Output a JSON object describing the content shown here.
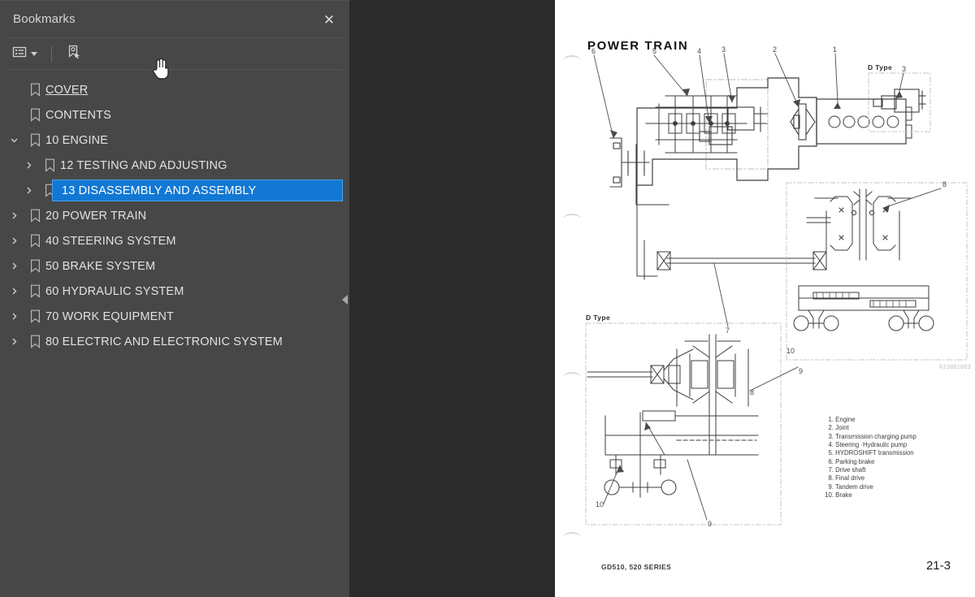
{
  "panel": {
    "title": "Bookmarks",
    "close_label": "✕",
    "toolbar": {
      "options_icon": "list-options-icon",
      "options_caret": "chevron-down-icon",
      "new_bookmark_icon": "new-bookmark-icon"
    },
    "collapse_icon": "collapse-panel-left-icon",
    "items": [
      {
        "label": "COVER",
        "depth": 0,
        "twisty": "none",
        "selected": false,
        "link": true
      },
      {
        "label": "CONTENTS",
        "depth": 0,
        "twisty": "none",
        "selected": false,
        "link": false
      },
      {
        "label": "10 ENGINE",
        "depth": 0,
        "twisty": "expanded",
        "selected": false,
        "link": false
      },
      {
        "label": "12 TESTING AND ADJUSTING",
        "depth": 1,
        "twisty": "collapsed",
        "selected": false,
        "link": false
      },
      {
        "label": "13 DISASSEMBLY AND ASSEMBLY",
        "depth": 1,
        "twisty": "collapsed",
        "selected": true,
        "link": false
      },
      {
        "label": "20 POWER TRAIN",
        "depth": 0,
        "twisty": "collapsed",
        "selected": false,
        "link": false
      },
      {
        "label": "40 STEERING SYSTEM",
        "depth": 0,
        "twisty": "collapsed",
        "selected": false,
        "link": false
      },
      {
        "label": "50 BRAKE SYSTEM",
        "depth": 0,
        "twisty": "collapsed",
        "selected": false,
        "link": false
      },
      {
        "label": "60 HYDRAULIC SYSTEM",
        "depth": 0,
        "twisty": "collapsed",
        "selected": false,
        "link": false
      },
      {
        "label": "70 WORK EQUIPMENT",
        "depth": 0,
        "twisty": "collapsed",
        "selected": false,
        "link": false
      },
      {
        "label": "80 ELECTRIC AND ELECTRONIC SYSTEM",
        "depth": 0,
        "twisty": "collapsed",
        "selected": false,
        "link": false
      }
    ]
  },
  "page": {
    "title": "POWER  TRAIN",
    "dtype_top_right": "D Type",
    "dtype_bottom_left": "D Type",
    "drawing_code": "F23801003",
    "footer_left": "GD510, 520 SERIES",
    "footer_right": "21-3",
    "legend": [
      {
        "num": "1.",
        "text": "Engine"
      },
      {
        "num": "2.",
        "text": "Joint"
      },
      {
        "num": "3.",
        "text": "Transmission charging pump"
      },
      {
        "num": "4.",
        "text": "Steering ·Hydraulic pump"
      },
      {
        "num": "5.",
        "text": "HYDROSHIFT transmission"
      },
      {
        "num": "6.",
        "text": "Parking brake"
      },
      {
        "num": "7.",
        "text": "Drive shaft"
      },
      {
        "num": "8.",
        "text": "Final drive"
      },
      {
        "num": "9.",
        "text": "Tandem drive"
      },
      {
        "num": "10.",
        "text": "Brake"
      }
    ],
    "callouts_main": [
      "6",
      "5",
      "4",
      "3",
      "2",
      "1",
      "7"
    ],
    "callouts_inset_tr": [
      "3"
    ],
    "callouts_right": [
      "8",
      "9",
      "10"
    ],
    "callouts_inset_bl": [
      "8",
      "9",
      "10"
    ]
  },
  "colors": {
    "panel_bg": "#474747",
    "viewer_bg": "#2b2b2b",
    "selection": "#1278d4",
    "page_bg": "#ffffff",
    "text": "#e2e2e2"
  }
}
